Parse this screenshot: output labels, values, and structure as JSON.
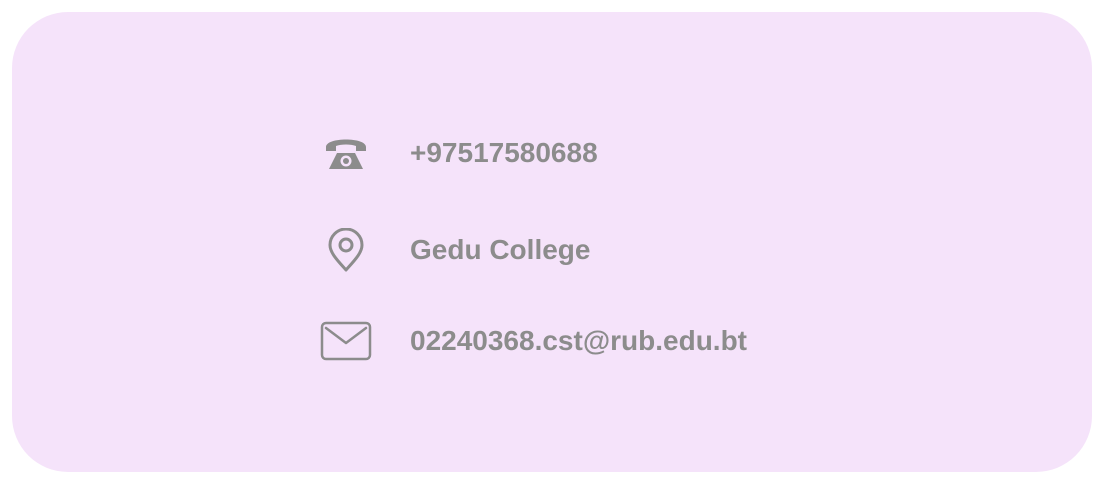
{
  "contact": {
    "items": [
      {
        "icon": "telephone-icon",
        "text": "+97517580688"
      },
      {
        "icon": "location-pin-icon",
        "text": "Gedu College"
      },
      {
        "icon": "envelope-icon",
        "text": "02240368.cst@rub.edu.bt"
      }
    ]
  },
  "colors": {
    "card_background": "#f5e3fa",
    "text": "#8c8c8c",
    "icon": "#8c8c8c"
  }
}
